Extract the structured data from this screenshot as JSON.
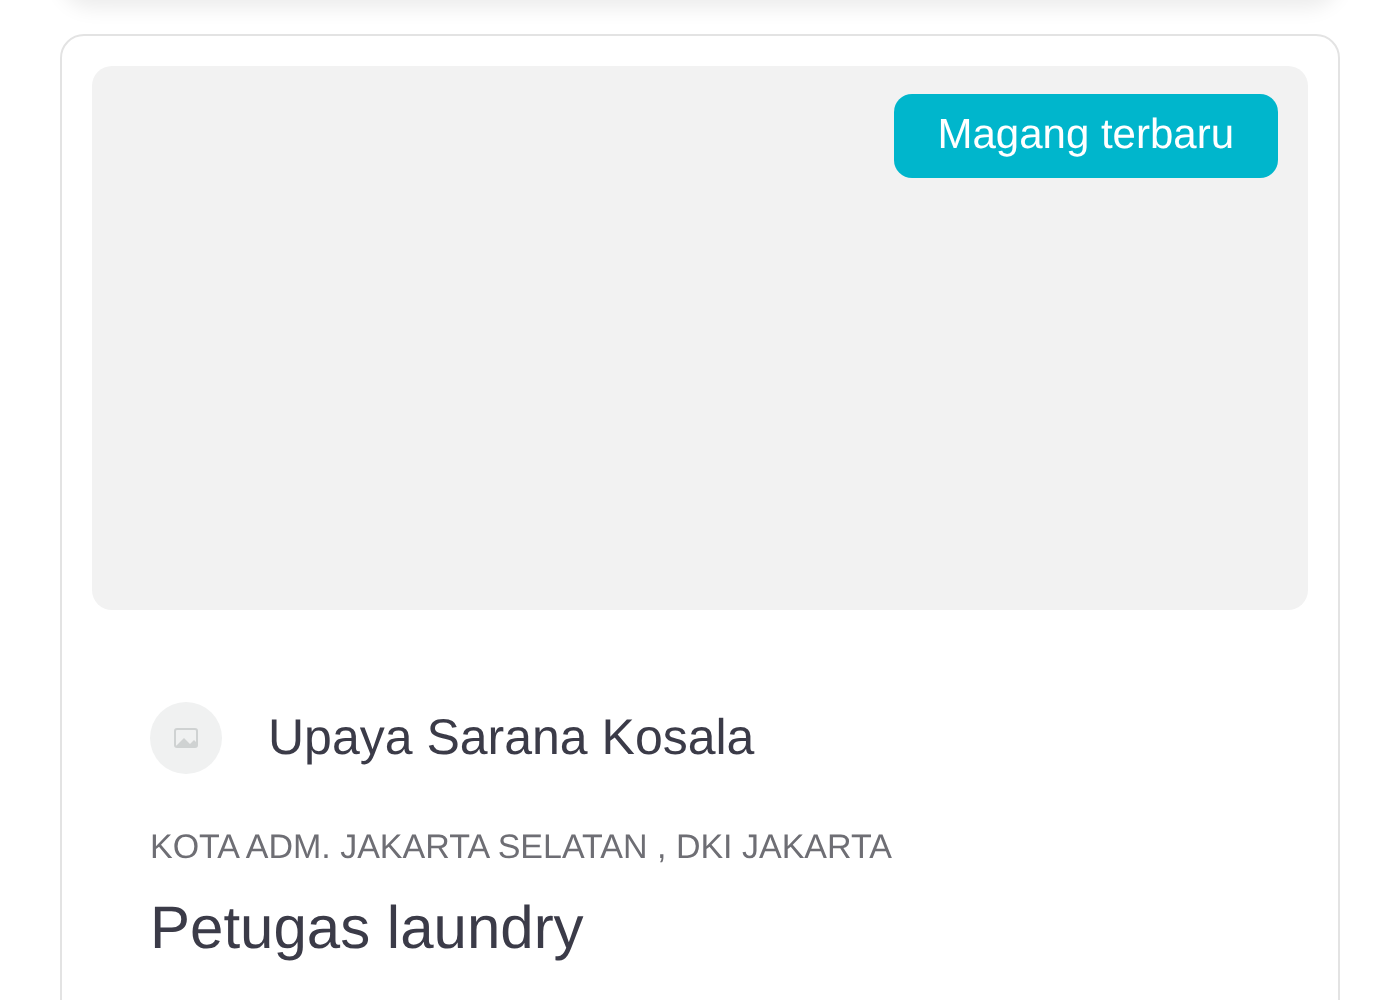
{
  "listing": {
    "badge": "Magang terbaru",
    "company": "Upaya Sarana Kosala",
    "location": "KOTA ADM. JAKARTA SELATAN , DKI JAKARTA",
    "title": "Petugas laundry"
  }
}
